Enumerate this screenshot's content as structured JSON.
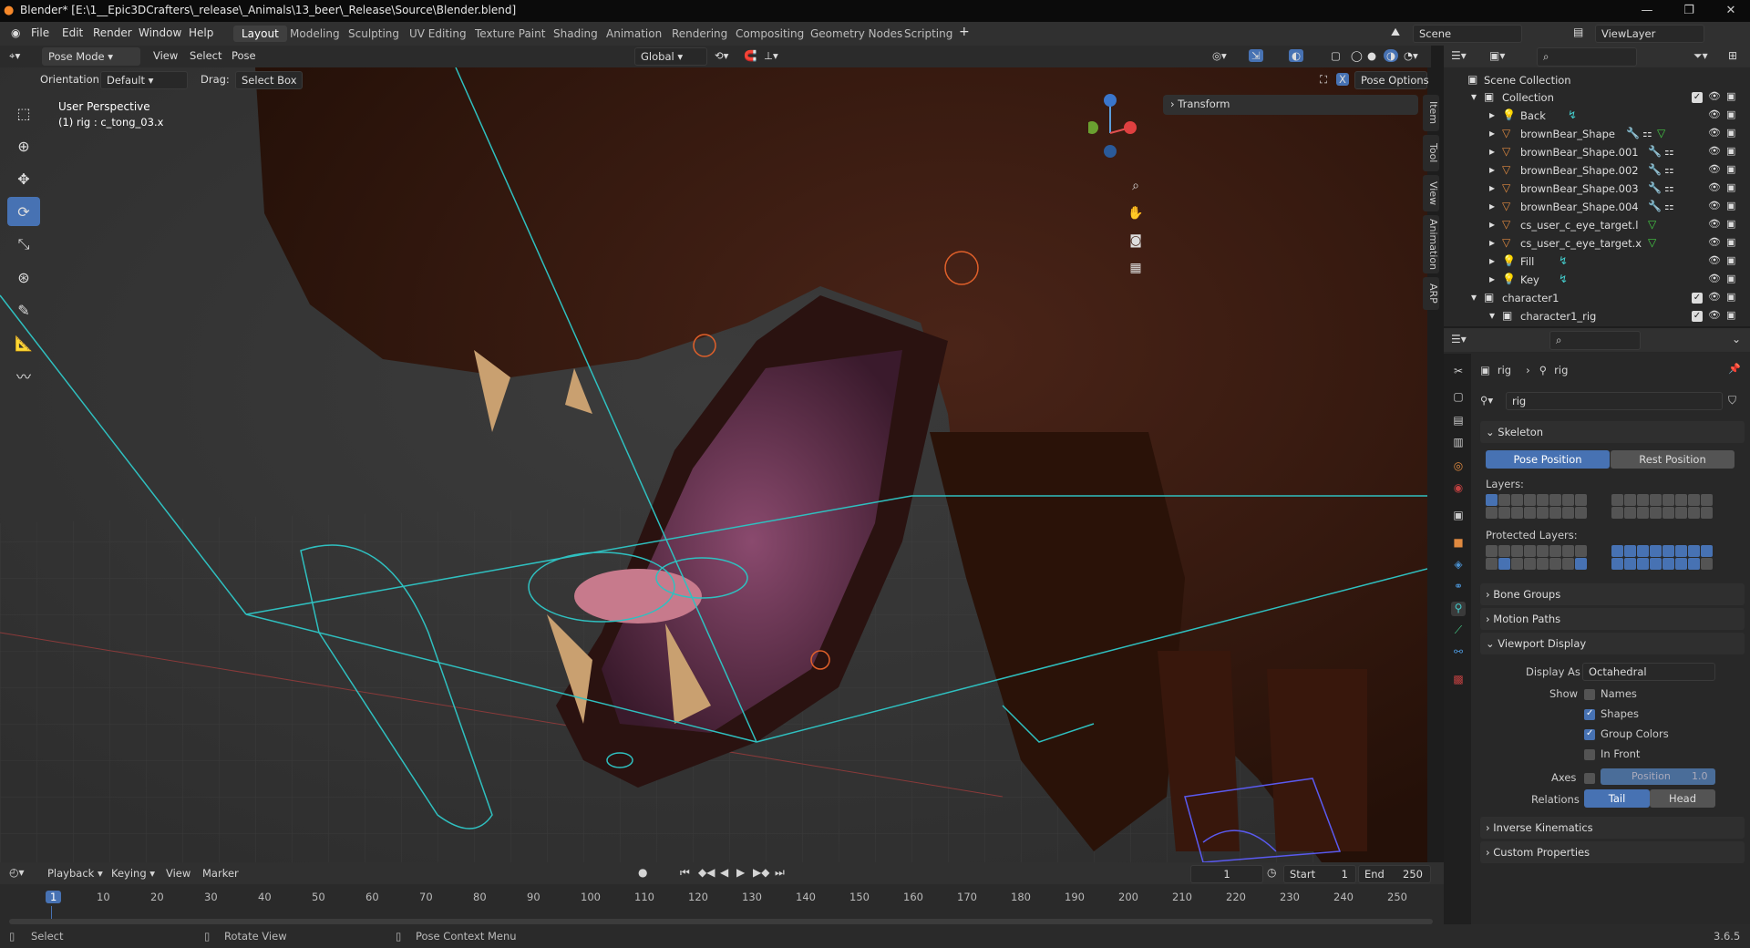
{
  "window": {
    "title": "Blender* [E:\\1__Epic3DCrafters\\_release\\_Animals\\13_beer\\_Release\\Source\\Blender.blend]"
  },
  "menus": [
    "File",
    "Edit",
    "Render",
    "Window",
    "Help"
  ],
  "workspaces": [
    "Layout",
    "Modeling",
    "Sculpting",
    "UV Editing",
    "Texture Paint",
    "Shading",
    "Animation",
    "Rendering",
    "Compositing",
    "Geometry Nodes",
    "Scripting"
  ],
  "active_workspace": "Layout",
  "scene": "Scene",
  "view_layer": "ViewLayer",
  "header3d": {
    "mode": "Pose Mode",
    "view": "View",
    "select": "Select",
    "pose": "Pose",
    "transform_orientation": "Global"
  },
  "header3d_row2": {
    "orientation_label": "Orientation:",
    "orientation_value": "Default",
    "drag_label": "Drag:",
    "drag_value": "Select Box",
    "pose_options": "Pose Options"
  },
  "viewport": {
    "perspective": "User Perspective",
    "object_info": "(1) rig : c_tong_03.x"
  },
  "transform_panel": "Transform",
  "side_tabs": [
    "Item",
    "Tool",
    "View",
    "Animation",
    "ARP"
  ],
  "outliner": {
    "root": "Scene Collection",
    "rows": [
      {
        "name": "Collection",
        "icon": "collection-icon",
        "depth": 0
      },
      {
        "name": "Back",
        "icon": "light-icon",
        "depth": 1
      },
      {
        "name": "brownBear_Shape",
        "icon": "mesh-icon",
        "depth": 1
      },
      {
        "name": "brownBear_Shape.001",
        "icon": "mesh-icon",
        "depth": 1
      },
      {
        "name": "brownBear_Shape.002",
        "icon": "mesh-icon",
        "depth": 1
      },
      {
        "name": "brownBear_Shape.003",
        "icon": "mesh-icon",
        "depth": 1
      },
      {
        "name": "brownBear_Shape.004",
        "icon": "mesh-icon",
        "depth": 1
      },
      {
        "name": "cs_user_c_eye_target.l",
        "icon": "mesh-icon",
        "depth": 1
      },
      {
        "name": "cs_user_c_eye_target.x",
        "icon": "mesh-icon",
        "depth": 1
      },
      {
        "name": "Fill",
        "icon": "light-icon",
        "depth": 1
      },
      {
        "name": "Key",
        "icon": "light-icon",
        "depth": 1
      },
      {
        "name": "character1",
        "icon": "collection-icon",
        "depth": 0
      },
      {
        "name": "character1_rig",
        "icon": "collection-icon",
        "depth": 1
      }
    ]
  },
  "properties": {
    "breadcrumb_object": "rig",
    "breadcrumb_data": "rig",
    "data_name": "rig",
    "skeleton": "Skeleton",
    "pose_position": "Pose Position",
    "rest_position": "Rest Position",
    "layers": "Layers:",
    "protected_layers": "Protected Layers:",
    "bone_groups": "Bone Groups",
    "motion_paths": "Motion Paths",
    "viewport_display": "Viewport Display",
    "display_as_label": "Display As",
    "display_as_value": "Octahedral",
    "show_label": "Show",
    "names": "Names",
    "shapes": "Shapes",
    "group_colors": "Group Colors",
    "in_front": "In Front",
    "axes_label": "Axes",
    "position_label": "Position",
    "position_value": "1.0",
    "relations_label": "Relations",
    "tail": "Tail",
    "head": "Head",
    "inverse_kinematics": "Inverse Kinematics",
    "custom_properties": "Custom Properties"
  },
  "timeline": {
    "playback": "Playback",
    "keying": "Keying",
    "view": "View",
    "marker": "Marker",
    "current_frame": "1",
    "start_label": "Start",
    "start": "1",
    "end_label": "End",
    "end": "250",
    "ticks": [
      "1",
      "10",
      "20",
      "30",
      "40",
      "50",
      "60",
      "70",
      "80",
      "90",
      "100",
      "110",
      "120",
      "130",
      "140",
      "150",
      "160",
      "170",
      "180",
      "190",
      "200",
      "210",
      "220",
      "230",
      "240",
      "250"
    ]
  },
  "status": {
    "select": "Select",
    "rotate": "Rotate View",
    "context": "Pose Context Menu",
    "version": "3.6.5"
  },
  "colors": {
    "accent": "#4772b3",
    "rig_lines": "#2fc0c0",
    "bone_orange": "#e0602a"
  }
}
